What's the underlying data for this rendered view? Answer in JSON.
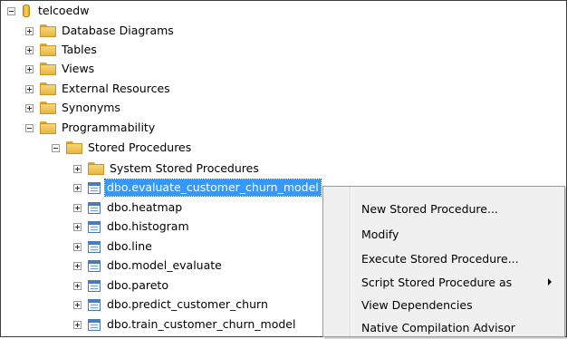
{
  "tree": {
    "database": "telcoedw",
    "folders": [
      {
        "label": "Database Diagrams"
      },
      {
        "label": "Tables"
      },
      {
        "label": "Views"
      },
      {
        "label": "External Resources"
      },
      {
        "label": "Synonyms"
      },
      {
        "label": "Programmability"
      }
    ],
    "stored_procedures_folder": "Stored Procedures",
    "system_stored_procedures": "System Stored Procedures",
    "procedures": [
      {
        "label": "dbo.evaluate_customer_churn_model",
        "selected": true
      },
      {
        "label": "dbo.heatmap"
      },
      {
        "label": "dbo.histogram"
      },
      {
        "label": "dbo.line"
      },
      {
        "label": "dbo.model_evaluate"
      },
      {
        "label": "dbo.pareto"
      },
      {
        "label": "dbo.predict_customer_churn"
      },
      {
        "label": "dbo.train_customer_churn_model"
      }
    ]
  },
  "context_menu": {
    "items": [
      {
        "label": "New Stored Procedure..."
      },
      {
        "label": "Modify"
      },
      {
        "label": "Execute Stored Procedure..."
      },
      {
        "label": "Script Stored Procedure as",
        "has_submenu": true
      },
      {
        "label": "View Dependencies"
      },
      {
        "label": "Native Compilation Advisor"
      }
    ]
  },
  "colors": {
    "selection": "#3399ff",
    "folder": "#f7d67b"
  }
}
